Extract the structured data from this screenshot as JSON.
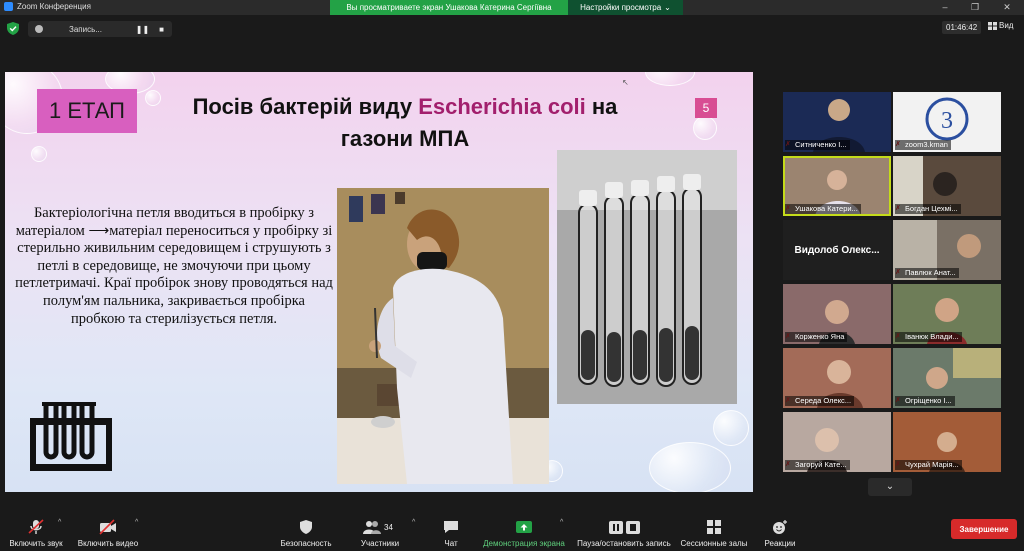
{
  "window": {
    "app_title": "Zoom Конференция",
    "minimize": "–",
    "maximize": "❐",
    "close": "✕"
  },
  "share": {
    "banner": "Вы просматриваете экран Ушакова Катерина Сергіївна",
    "view_options": "Настройки просмотра",
    "view_options_caret": "⌄"
  },
  "recording": {
    "label": "Запись...",
    "pause": "❚❚",
    "stop": "■"
  },
  "meeting": {
    "timer": "01:46:42",
    "view_label": "Вид"
  },
  "slide": {
    "stage": "1 ЕТАП",
    "title_part1": "Посів бактерій виду ",
    "title_em": "Escherichia coli",
    "title_part2": " на газони МПА",
    "page": "5",
    "body": "Бактеріологічна петля вводиться в пробірку з матеріалом    ⟶матеріал переноситься у пробірку зі стерильно живильним середовищем і струшують з петлі в середовище, не змочуючи при цьому петлетримачі. Краї пробірок знову проводяться над полум'ям пальника, закривається пробірка пробкою та стерилізується петля."
  },
  "gallery": {
    "participants": [
      {
        "name": "Ситниченко І...",
        "bg": "#1b2a55"
      },
      {
        "name": "zoom3.kman",
        "bg": "#f2f2f2"
      },
      {
        "name": "Ушакова Катери...",
        "bg": "#9b8470"
      },
      {
        "name": "Богдан Цехмі...",
        "bg": "#5a4a3d"
      },
      {
        "name": "Видолоб  Олекс...",
        "bg": "#1f1f1f"
      },
      {
        "name": "Павлюк Анат...",
        "bg": "#7a7065"
      },
      {
        "name": "Корженко Яна",
        "bg": "#8a6a6a"
      },
      {
        "name": "Іванюк Влади...",
        "bg": "#6e7d58"
      },
      {
        "name": "Середа Олекс...",
        "bg": "#a36b58"
      },
      {
        "name": "Огріщенко І...",
        "bg": "#6b7a6a"
      },
      {
        "name": "Загоруй Кате...",
        "bg": "#b8a8a0"
      },
      {
        "name": "Чухрай Марія...",
        "bg": "#a35c38"
      }
    ],
    "page_down": "⌄"
  },
  "toolbar": {
    "mute": "Включить звук",
    "video": "Включить видео",
    "security": "Безопасность",
    "participants": "Участники",
    "participants_count": "34",
    "chat": "Чат",
    "share": "Демонстрация экрана",
    "pause_record": "Пауза/остановить запись",
    "breakout": "Сессионные залы",
    "reactions": "Реакции",
    "end": "Завершение",
    "caret": "^"
  },
  "colors": {
    "share_green": "#23a246",
    "end_red": "#d72a2a",
    "active_speaker": "#c4db1a",
    "slide_accent": "#d85fbf",
    "title_em": "#a21f6d"
  }
}
